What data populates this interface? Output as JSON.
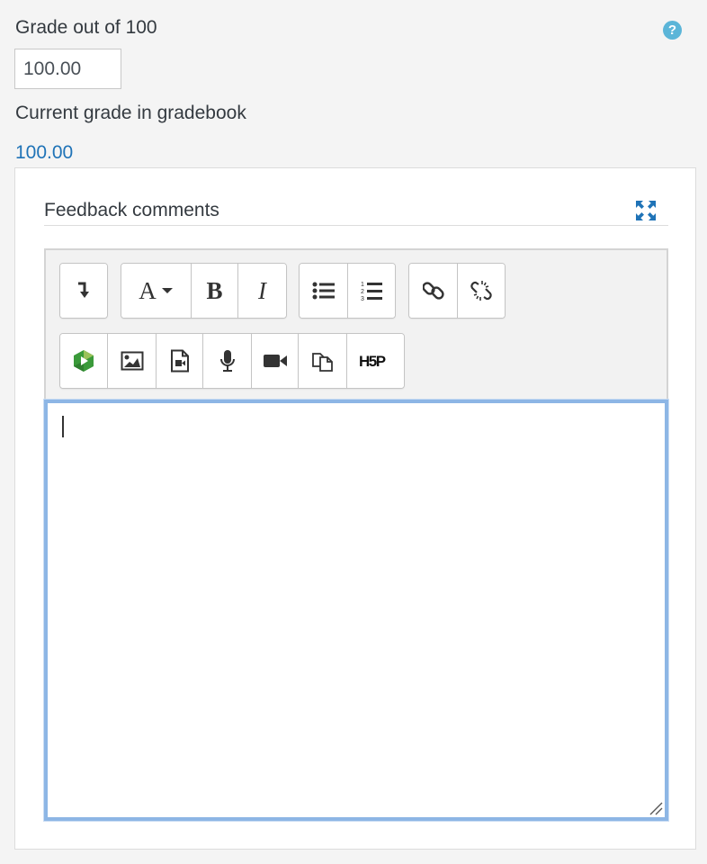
{
  "grade": {
    "label": "Grade out of 100",
    "value": "100.00",
    "help_icon": "question-circle-icon"
  },
  "current_grade": {
    "label": "Current grade in gradebook",
    "value": "100.00"
  },
  "feedback": {
    "title": "Feedback comments",
    "expand_icon": "fullscreen-expand-icon",
    "editor_text": ""
  },
  "toolbar": {
    "row1": [
      [
        "show-more-buttons"
      ],
      [
        "font-styles",
        "bold",
        "italic"
      ],
      [
        "unordered-list",
        "ordered-list"
      ],
      [
        "link",
        "unlink"
      ]
    ],
    "row2": [
      [
        "media-plugin",
        "image",
        "media",
        "record-audio",
        "record-video",
        "manage-files",
        "h5p"
      ]
    ],
    "labels": {
      "bold": "B",
      "italic": "I",
      "font_styles": "A",
      "h5p": "H5P"
    }
  },
  "colors": {
    "link_blue": "#1f73b7",
    "help_icon": "#5bb5d8",
    "focus_border": "#8db6e5"
  }
}
